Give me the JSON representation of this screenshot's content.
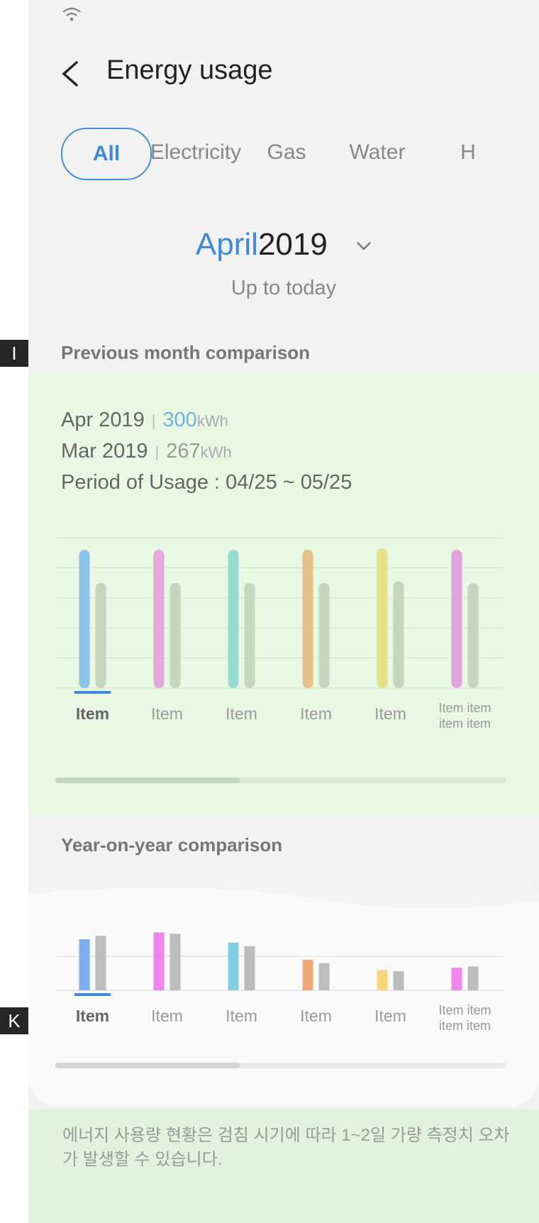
{
  "side_markers": {
    "marker_1": "I",
    "marker_2": "K"
  },
  "header": {
    "title": "Energy usage"
  },
  "tabs": [
    {
      "label": "All",
      "active": true
    },
    {
      "label": "Electricity"
    },
    {
      "label": "Gas"
    },
    {
      "label": "Water"
    },
    {
      "label": "H"
    }
  ],
  "period": {
    "month": "April",
    "year": "2019",
    "subtitle": "Up to today"
  },
  "sections": {
    "previous_month": {
      "title": "Previous month comparison",
      "current": {
        "label": "Apr 2019",
        "value": "300",
        "unit": "kWh"
      },
      "previous": {
        "label": "Mar 2019",
        "value": "267",
        "unit": "kWh"
      },
      "period_text": "Period of Usage : 04/25 ~ 05/25",
      "scroll_position": 0.41
    },
    "year_on_year": {
      "title": "Year-on-year comparison",
      "scroll_position": 0.41
    }
  },
  "notice": "에너지 사용량 현황은 검침 시기에 따라 1~2일 가량 측정치 오차가 발생할 수 있습니다.",
  "chart_data": [
    {
      "type": "bar",
      "categories": [
        "Item",
        "Item",
        "Item",
        "Item",
        "Item",
        "Item item item item"
      ],
      "series": [
        {
          "values": [
            92,
            92,
            92,
            92,
            93,
            92
          ]
        },
        {
          "values": [
            70,
            70,
            70,
            70,
            71,
            70
          ]
        }
      ],
      "colors": [
        "#8cc3e8",
        "#e4a8de",
        "#93dcd4",
        "#e8c08a",
        "#e7e287",
        "#e2a3dc"
      ],
      "compare_color": "#c8d5bd",
      "selected_index": 0,
      "ylim": [
        0,
        100
      ],
      "grid": true
    },
    {
      "type": "bar",
      "categories": [
        "Item",
        "Item",
        "Item",
        "Item",
        "Item",
        "Item item item item"
      ],
      "series": [
        {
          "values": [
            75,
            85,
            70,
            45,
            30,
            33
          ]
        },
        {
          "values": [
            80,
            83,
            65,
            40,
            28,
            35
          ]
        }
      ],
      "colors": [
        "#7daef0",
        "#ef86ef",
        "#80cde8",
        "#efaa78",
        "#f7d67e",
        "#ee86ee"
      ],
      "compare_color": "#bcbcbc",
      "selected_index": 0,
      "ylim": [
        0,
        100
      ],
      "grid": true
    }
  ]
}
